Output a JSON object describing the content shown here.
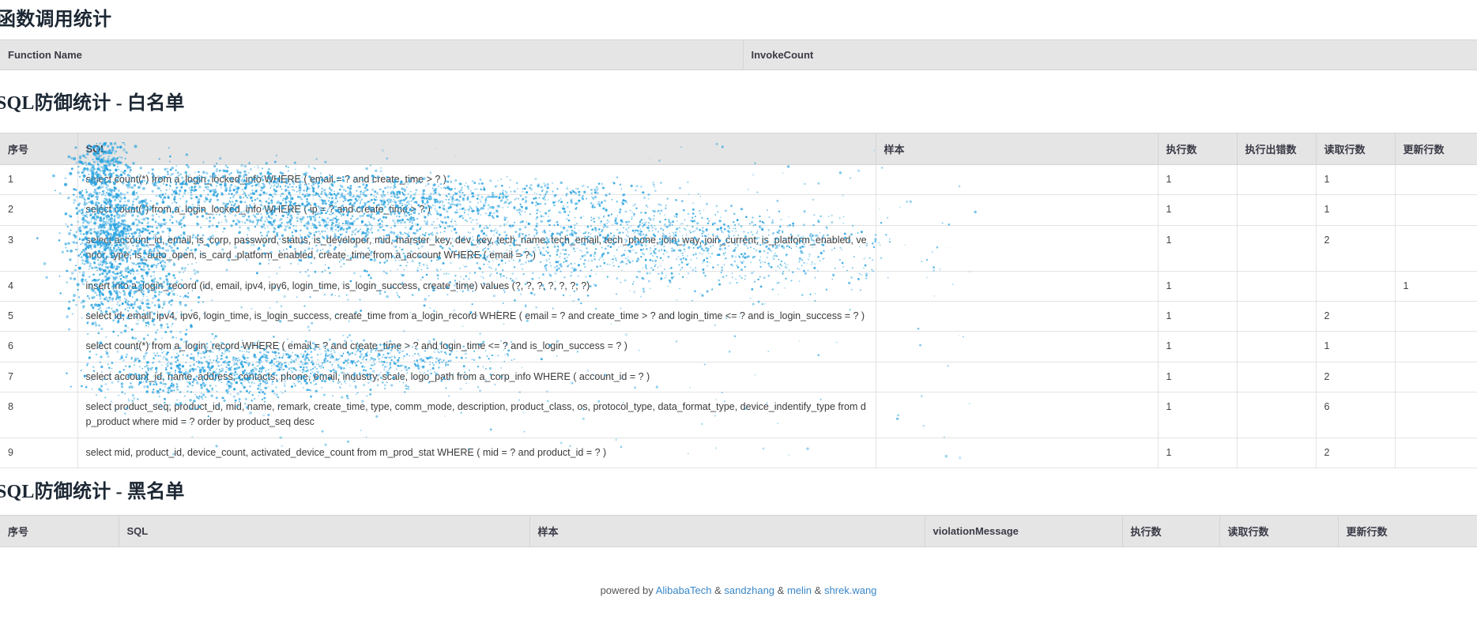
{
  "sections": {
    "function_stat": {
      "title": "函数调用统计",
      "columns": [
        "Function Name",
        "InvokeCount"
      ],
      "rows": []
    },
    "sql_whitelist": {
      "title": "SQL防御统计 - 白名单",
      "columns": [
        "序号",
        "SQL",
        "样本",
        "执行数",
        "执行出错数",
        "读取行数",
        "更新行数"
      ],
      "rows": [
        {
          "seq": "1",
          "sql": "select count(*) from a_login_locked_info WHERE ( email = ? and create_time > ? )",
          "sample": "",
          "exec": "1",
          "error": "",
          "read": "1",
          "update": ""
        },
        {
          "seq": "2",
          "sql": "select count(*) from a_login_locked_info WHERE ( ip = ? and create_time > ? )",
          "sample": "",
          "exec": "1",
          "error": "",
          "read": "1",
          "update": ""
        },
        {
          "seq": "3",
          "sql": "select account_id, email, is_corp, password, status, is_developer, mid, marster_key, dev_key, tech_name, tech_email, tech_phone, join_way, join_current, is_platform_enabled, vendor, type, is_auto_open, is_card_platform_enabled, create_time from a_account WHERE ( email = ? )",
          "sample": "",
          "exec": "1",
          "error": "",
          "read": "2",
          "update": ""
        },
        {
          "seq": "4",
          "sql": "insert into a_login_record (id, email, ipv4, ipv6, login_time, is_login_success, create_time) values (?, ?, ?, ?, ?, ?, ?)",
          "sample": "",
          "exec": "1",
          "error": "",
          "read": "",
          "update": "1"
        },
        {
          "seq": "5",
          "sql": "select id, email, ipv4, ipv6, login_time, is_login_success, create_time from a_login_record WHERE ( email = ? and create_time > ? and login_time <= ? and is_login_success = ? )",
          "sample": "",
          "exec": "1",
          "error": "",
          "read": "2",
          "update": ""
        },
        {
          "seq": "6",
          "sql": "select count(*) from a_login_record WHERE ( email = ? and create_time > ? and login_time <= ? and is_login_success = ? )",
          "sample": "",
          "exec": "1",
          "error": "",
          "read": "1",
          "update": ""
        },
        {
          "seq": "7",
          "sql": "select account_id, name, address, contacts, phone, email, industry, scale, logo_path from a_corp_info WHERE ( account_id = ? )",
          "sample": "",
          "exec": "1",
          "error": "",
          "read": "2",
          "update": ""
        },
        {
          "seq": "8",
          "sql": "select product_seq, product_id, mid, name, remark, create_time, type, comm_mode, description, product_class, os, protocol_type, data_format_type, device_indentify_type from dp_product where mid = ? order by product_seq desc",
          "sample": "",
          "exec": "1",
          "error": "",
          "read": "6",
          "update": ""
        },
        {
          "seq": "9",
          "sql": "select mid, product_id, device_count, activated_device_count from m_prod_stat WHERE ( mid = ? and product_id = ? )",
          "sample": "",
          "exec": "1",
          "error": "",
          "read": "2",
          "update": ""
        }
      ]
    },
    "sql_blacklist": {
      "title": "SQL防御统计 - 黑名单",
      "columns": [
        "序号",
        "SQL",
        "样本",
        "violationMessage",
        "执行数",
        "读取行数",
        "更新行数"
      ],
      "rows": []
    }
  },
  "footer": {
    "prefix": "powered by",
    "links": [
      "AlibabaTech",
      "sandzhang",
      "melin",
      "shrek.wang"
    ],
    "separator": "&"
  },
  "theme": {
    "header_bg": "#e5e5e5",
    "link_color": "#3a87c8",
    "noise_color": "#29a3e0",
    "text_color": "#333333"
  }
}
